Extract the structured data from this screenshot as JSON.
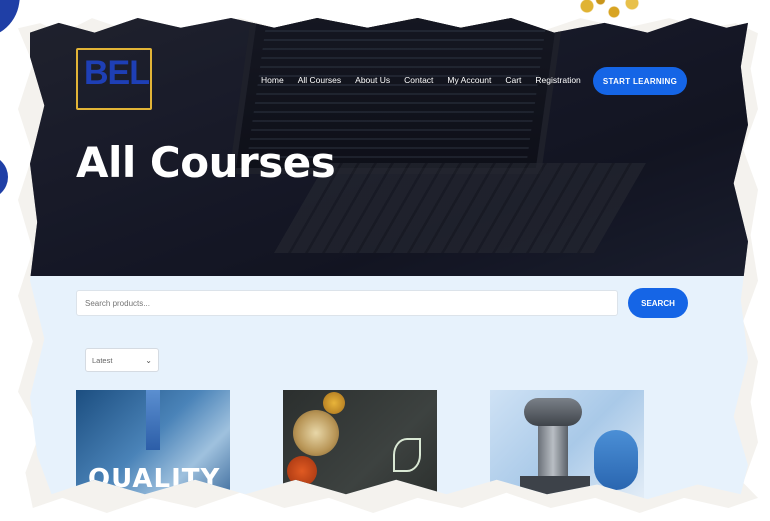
{
  "logo": {
    "text": "BEL"
  },
  "nav": {
    "items": [
      {
        "label": "Home"
      },
      {
        "label": "All Courses"
      },
      {
        "label": "About Us"
      },
      {
        "label": "Contact"
      },
      {
        "label": "My Account"
      },
      {
        "label": "Cart"
      },
      {
        "label": "Registration"
      }
    ],
    "cta_label": "START LEARNING"
  },
  "hero": {
    "title": "All Courses"
  },
  "search": {
    "placeholder": "Search products...",
    "button_label": "SEARCH"
  },
  "sort": {
    "selected": "Latest"
  },
  "products": [
    {
      "image": "quality-image",
      "image_text": "QUALITY"
    },
    {
      "image": "spices-image"
    },
    {
      "image": "microscope-image"
    }
  ],
  "colors": {
    "accent": "#1565e6",
    "hero_bg": "#1e2030",
    "content_bg": "#e7f2fc",
    "logo_gold": "#e2b437",
    "logo_blue": "#1e3fb5"
  }
}
